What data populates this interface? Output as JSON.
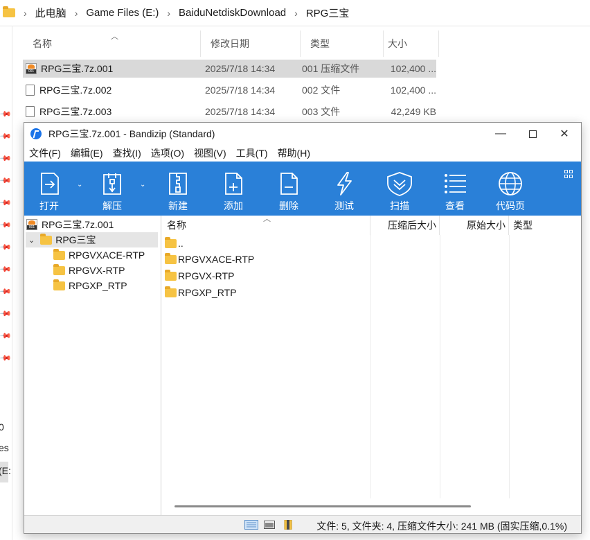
{
  "explorer": {
    "breadcrumb": [
      "此电脑",
      "Game Files (E:)",
      "BaiduNetdiskDownload",
      "RPG三宝"
    ],
    "columns": {
      "name": "名称",
      "date": "修改日期",
      "type": "类型",
      "size": "大小"
    },
    "files": [
      {
        "name": "RPG三宝.7z.001",
        "date": "2025/7/18 14:34",
        "type": "001 压缩文件",
        "size": "102,400 ...",
        "icon": "bandizip-archive-icon",
        "selected": true
      },
      {
        "name": "RPG三宝.7z.002",
        "date": "2025/7/18 14:34",
        "type": "002 文件",
        "size": "102,400 ...",
        "icon": "file-icon",
        "selected": false
      },
      {
        "name": "RPG三宝.7z.003",
        "date": "2025/7/18 14:34",
        "type": "003 文件",
        "size": "42,249 KB",
        "icon": "file-icon",
        "selected": false
      }
    ],
    "left_fragments": [
      "0",
      "es",
      "(E:"
    ]
  },
  "bandizip": {
    "title": "RPG三宝.7z.001 - Bandizip (Standard)",
    "menu": [
      "文件(F)",
      "编辑(E)",
      "查找(I)",
      "选项(O)",
      "视图(V)",
      "工具(T)",
      "帮助(H)"
    ],
    "toolbar": [
      {
        "label": "打开",
        "icon": "open-icon"
      },
      {
        "label": "解压",
        "icon": "extract-icon"
      },
      {
        "label": "新建",
        "icon": "new-archive-icon"
      },
      {
        "label": "添加",
        "icon": "add-icon"
      },
      {
        "label": "删除",
        "icon": "delete-icon"
      },
      {
        "label": "测试",
        "icon": "test-icon"
      },
      {
        "label": "扫描",
        "icon": "scan-icon"
      },
      {
        "label": "查看",
        "icon": "view-icon"
      },
      {
        "label": "代码页",
        "icon": "codepage-icon"
      }
    ],
    "tree": {
      "root": "RPG三宝.7z.001",
      "folder": "RPG三宝",
      "children": [
        "RPGVXACE-RTP",
        "RPGVX-RTP",
        "RPGXP_RTP"
      ]
    },
    "list": {
      "columns": {
        "name": "名称",
        "packed": "压缩后大小",
        "original": "原始大小",
        "type": "类型"
      },
      "rows": [
        "..",
        "RPGVXACE-RTP",
        "RPGVX-RTP",
        "RPGXP_RTP"
      ]
    },
    "status": "文件: 5, 文件夹: 4, 压缩文件大小: 241 MB (固实压缩,0.1%)",
    "colors": {
      "toolbar": "#2a80d8",
      "folder": "#f6c343"
    }
  }
}
